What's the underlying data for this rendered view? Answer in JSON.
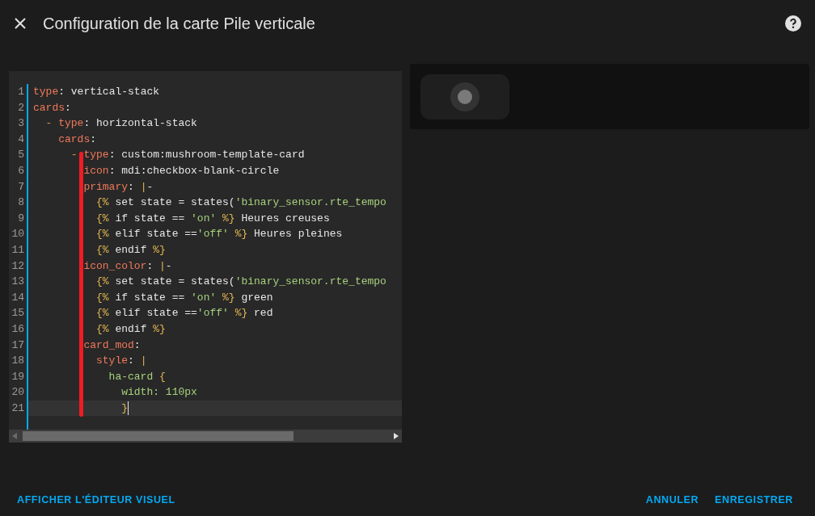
{
  "dialog": {
    "title": "Configuration de la carte Pile verticale"
  },
  "editor": {
    "lines": [
      {
        "number": "1",
        "current": false,
        "tokens": [
          {
            "kind": "key",
            "text": "type"
          },
          {
            "kind": "text",
            "text": ": vertical-stack"
          }
        ]
      },
      {
        "number": "2",
        "current": false,
        "tokens": [
          {
            "kind": "key",
            "text": "cards"
          },
          {
            "kind": "text",
            "text": ":"
          }
        ]
      },
      {
        "number": "3",
        "current": false,
        "tokens": [
          {
            "kind": "dash",
            "text": "  - "
          },
          {
            "kind": "key",
            "text": "type"
          },
          {
            "kind": "text",
            "text": ": horizontal-stack"
          }
        ]
      },
      {
        "number": "4",
        "current": false,
        "tokens": [
          {
            "kind": "key",
            "text": "    cards"
          },
          {
            "kind": "text",
            "text": ":"
          }
        ]
      },
      {
        "number": "5",
        "current": false,
        "tokens": [
          {
            "kind": "dash",
            "text": "      - "
          },
          {
            "kind": "key",
            "text": "type"
          },
          {
            "kind": "text",
            "text": ": custom:mushroom-template-card"
          }
        ]
      },
      {
        "number": "6",
        "current": false,
        "tokens": [
          {
            "kind": "key",
            "text": "        icon"
          },
          {
            "kind": "text",
            "text": ": mdi:checkbox-blank-circle"
          }
        ]
      },
      {
        "number": "7",
        "current": false,
        "tokens": [
          {
            "kind": "key",
            "text": "        primary"
          },
          {
            "kind": "text",
            "text": ": "
          },
          {
            "kind": "punct",
            "text": "|"
          },
          {
            "kind": "text",
            "text": "-"
          }
        ]
      },
      {
        "number": "8",
        "current": false,
        "tokens": [
          {
            "kind": "punct",
            "text": "          {%"
          },
          {
            "kind": "text",
            "text": " set state = states("
          },
          {
            "kind": "string",
            "text": "'binary_sensor.rte_tempo"
          }
        ]
      },
      {
        "number": "9",
        "current": false,
        "tokens": [
          {
            "kind": "punct",
            "text": "          {%"
          },
          {
            "kind": "text",
            "text": " if state == "
          },
          {
            "kind": "string",
            "text": "'on'"
          },
          {
            "kind": "punct",
            "text": " %}"
          },
          {
            "kind": "text",
            "text": " Heures creuses"
          }
        ]
      },
      {
        "number": "10",
        "current": false,
        "tokens": [
          {
            "kind": "punct",
            "text": "          {%"
          },
          {
            "kind": "text",
            "text": " elif state =="
          },
          {
            "kind": "string",
            "text": "'off'"
          },
          {
            "kind": "punct",
            "text": " %}"
          },
          {
            "kind": "text",
            "text": " Heures pleines"
          }
        ]
      },
      {
        "number": "11",
        "current": false,
        "tokens": [
          {
            "kind": "punct",
            "text": "          {%"
          },
          {
            "kind": "text",
            "text": " endif "
          },
          {
            "kind": "punct",
            "text": "%}"
          }
        ]
      },
      {
        "number": "12",
        "current": false,
        "tokens": [
          {
            "kind": "key",
            "text": "        icon_color"
          },
          {
            "kind": "text",
            "text": ": "
          },
          {
            "kind": "punct",
            "text": "|"
          },
          {
            "kind": "text",
            "text": "-"
          }
        ]
      },
      {
        "number": "13",
        "current": false,
        "tokens": [
          {
            "kind": "punct",
            "text": "          {%"
          },
          {
            "kind": "text",
            "text": " set state = states("
          },
          {
            "kind": "string",
            "text": "'binary_sensor.rte_tempo"
          }
        ]
      },
      {
        "number": "14",
        "current": false,
        "tokens": [
          {
            "kind": "punct",
            "text": "          {%"
          },
          {
            "kind": "text",
            "text": " if state == "
          },
          {
            "kind": "string",
            "text": "'on'"
          },
          {
            "kind": "punct",
            "text": " %}"
          },
          {
            "kind": "text",
            "text": " green"
          }
        ]
      },
      {
        "number": "15",
        "current": false,
        "tokens": [
          {
            "kind": "punct",
            "text": "          {%"
          },
          {
            "kind": "text",
            "text": " elif state =="
          },
          {
            "kind": "string",
            "text": "'off'"
          },
          {
            "kind": "punct",
            "text": " %}"
          },
          {
            "kind": "text",
            "text": " red"
          }
        ]
      },
      {
        "number": "16",
        "current": false,
        "tokens": [
          {
            "kind": "punct",
            "text": "          {%"
          },
          {
            "kind": "text",
            "text": " endif "
          },
          {
            "kind": "punct",
            "text": "%}"
          }
        ]
      },
      {
        "number": "17",
        "current": false,
        "tokens": [
          {
            "kind": "key",
            "text": "        card_mod"
          },
          {
            "kind": "text",
            "text": ":"
          }
        ]
      },
      {
        "number": "18",
        "current": false,
        "tokens": [
          {
            "kind": "key",
            "text": "          style"
          },
          {
            "kind": "text",
            "text": ": "
          },
          {
            "kind": "punct",
            "text": "|"
          }
        ]
      },
      {
        "number": "19",
        "current": false,
        "tokens": [
          {
            "kind": "string",
            "text": "            ha-card "
          },
          {
            "kind": "punct",
            "text": "{"
          }
        ]
      },
      {
        "number": "20",
        "current": false,
        "tokens": [
          {
            "kind": "string",
            "text": "              width: 110px"
          }
        ]
      },
      {
        "number": "21",
        "current": true,
        "tokens": [
          {
            "kind": "punct",
            "text": "              }"
          }
        ]
      }
    ]
  },
  "footer": {
    "left_button": "AFFICHER L'ÉDITEUR VISUEL",
    "buttons": [
      "ANNULER",
      "ENREGISTRER"
    ]
  }
}
